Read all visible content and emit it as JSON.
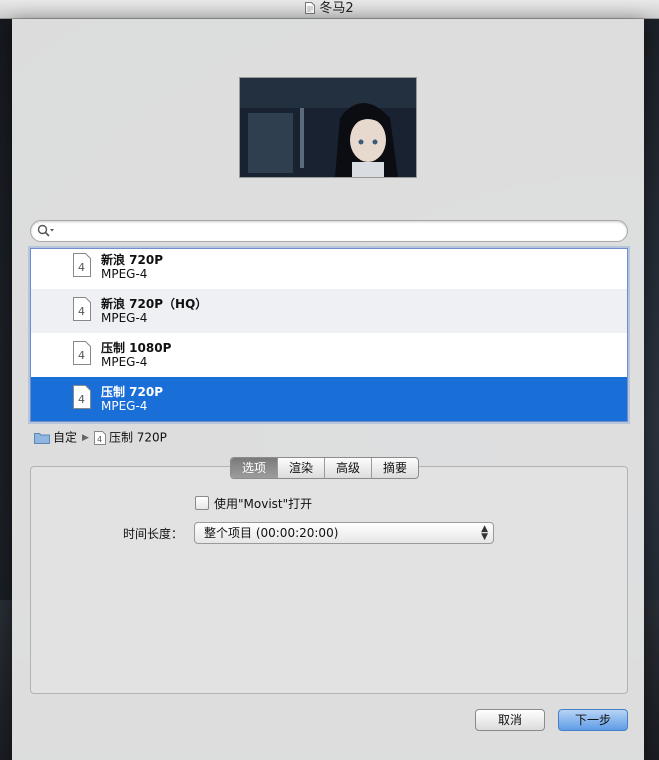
{
  "window": {
    "title": "冬马2"
  },
  "search": {
    "placeholder": ""
  },
  "presets": [
    {
      "name": "新浪 720P",
      "format": "MPEG-4",
      "icon": "mpeg4-file-icon"
    },
    {
      "name": "新浪 720P（HQ）",
      "format": "MPEG-4",
      "icon": "mpeg4-file-icon"
    },
    {
      "name": "压制 1080P",
      "format": "MPEG-4",
      "icon": "mpeg4-file-icon"
    },
    {
      "name": "压制 720P",
      "format": "MPEG-4",
      "icon": "mpeg4-file-icon",
      "selected": true
    }
  ],
  "breadcrumb": {
    "folder": "自定",
    "item": "压制 720P"
  },
  "tabs": [
    {
      "label": "选项",
      "active": true
    },
    {
      "label": "渲染"
    },
    {
      "label": "高级"
    },
    {
      "label": "摘要"
    }
  ],
  "options": {
    "open_with_label": "使用\"Movist\"打开",
    "open_with_checked": false,
    "duration_label": "时间长度：",
    "duration_value": "整个项目 (00:00:20:00)"
  },
  "buttons": {
    "cancel": "取消",
    "next": "下一步"
  },
  "colors": {
    "selection": "#1a6ed8",
    "default_button": "#5f9de6"
  }
}
